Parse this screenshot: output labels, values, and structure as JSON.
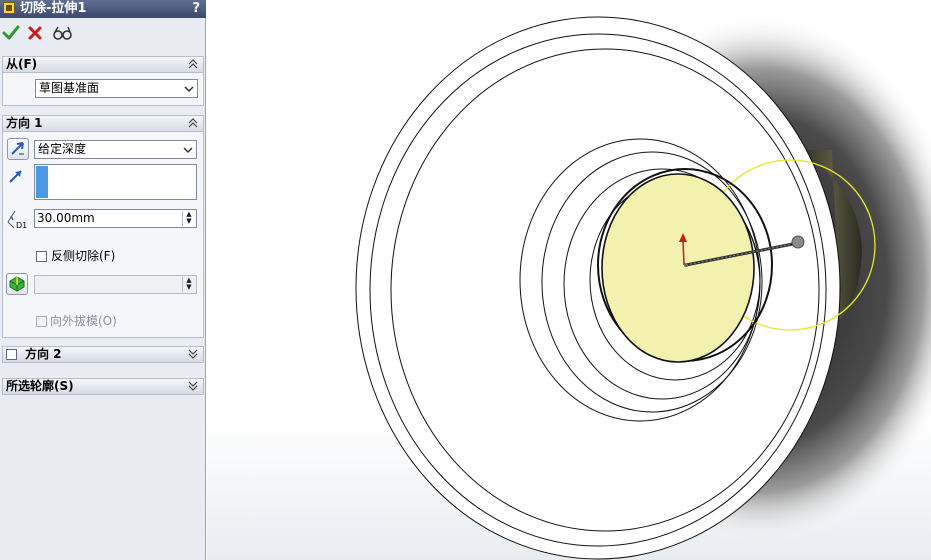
{
  "panel": {
    "title": "切除-拉伸1",
    "help_label": "?",
    "actions": {
      "ok": "check-icon",
      "cancel": "close-icon",
      "preview": "detailed-preview-icon"
    },
    "from_section": {
      "label": "从(F)",
      "start_condition": "草图基准面"
    },
    "direction1": {
      "label": "方向 1",
      "end_condition": "给定深度",
      "depth": "30.00mm",
      "depth_label": "D1",
      "flip_side_label": "反侧切除(F)",
      "flip_side_checked": false,
      "draft_value": "",
      "draft_outward_label": "向外拔模(O)"
    },
    "direction2": {
      "label": "方向 2",
      "checked": false
    },
    "selected_contours": {
      "label": "所选轮廓(S)"
    }
  },
  "colors": {
    "title_bg": "#4a5a7d",
    "accent_blue": "#4a98e6",
    "profile_fill": "#f2f1ad",
    "preview_outline": "#e6e629",
    "ok_green": "#2b9b2b",
    "cancel_red": "#d01818"
  }
}
